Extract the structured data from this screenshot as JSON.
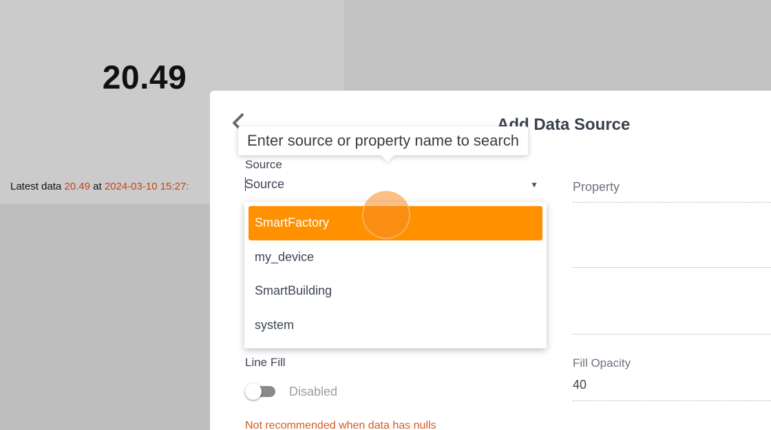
{
  "dashboard": {
    "big_value": "20.49",
    "latest": {
      "prefix": "Latest data",
      "value": "20.49",
      "middle": "at",
      "timestamp": "2024-03-10 15:27:"
    }
  },
  "modal": {
    "title": "Add Data Source",
    "tooltip": "Enter source or property name to search",
    "source": {
      "label": "Source",
      "value": "Source"
    },
    "property": {
      "label": "Property"
    },
    "dropdown": {
      "items": [
        "SmartFactory",
        "my_device",
        "SmartBuilding",
        "system"
      ],
      "highlighted_index": 0
    },
    "line_fill": {
      "label": "Line Fill",
      "state": "Disabled",
      "warning": "Not recommended when data has nulls"
    },
    "fill_opacity": {
      "label": "Fill Opacity",
      "value": "40"
    }
  },
  "colors": {
    "accent": "#ff9000",
    "warning": "#d35a24",
    "latest_accent": "#c2451e"
  }
}
